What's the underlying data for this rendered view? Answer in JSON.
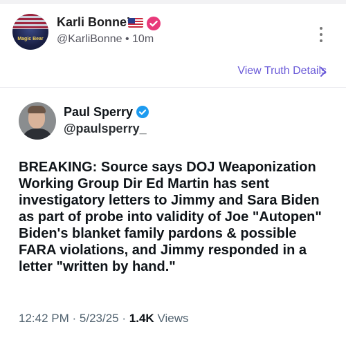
{
  "truth_post": {
    "author_name": "Karli Bonne’",
    "avatar_text": "Magic Bear",
    "handle": "@KarliBonne",
    "time_sep": "•",
    "time": "10m",
    "view_details": "View Truth Details"
  },
  "embedded_post": {
    "name": "Paul Sperry",
    "handle": "@paulsperry_",
    "text": "BREAKING: Source says DOJ Weaponization Working Group Dir Ed Martin has sent investigatory letters to Jimmy and Sara Biden as part of probe into validity of Joe \"Autopen\" Biden's blanket family pardons & possible FARA violations, and Jimmy responded in a letter \"written by hand.\"",
    "time": "12:42 PM",
    "date": "5/23/25",
    "sep": "·",
    "views_count": "1.4K",
    "views_label": "Views"
  },
  "colors": {
    "accent": "#6a5ad8",
    "verified_pink": "#e8397a",
    "verified_blue": "#1d9bf0"
  }
}
